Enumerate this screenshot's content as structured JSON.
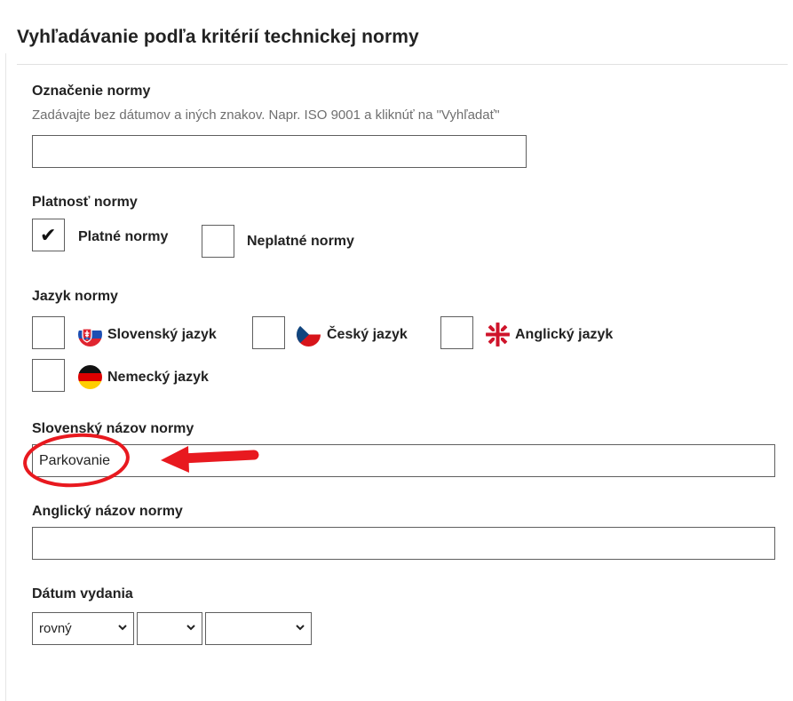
{
  "form": {
    "title": "Vyhľadávanie podľa kritérií technickej normy",
    "designation": {
      "label": "Označenie normy",
      "hint": "Zadávajte bez dátumov a iných znakov. Napr. ISO 9001 a kliknúť na \"Vyhľadať\"",
      "value": ""
    },
    "validity": {
      "label": "Platnosť normy",
      "options": [
        {
          "label": "Platné normy",
          "checked": true
        },
        {
          "label": "Neplatné normy",
          "checked": false
        }
      ]
    },
    "language": {
      "label": "Jazyk normy",
      "options": [
        {
          "label": "Slovenský jazyk",
          "flag": "slovak-flag-icon",
          "checked": false
        },
        {
          "label": "Český jazyk",
          "flag": "czech-flag-icon",
          "checked": false
        },
        {
          "label": "Anglický jazyk",
          "flag": "uk-flag-icon",
          "checked": false
        },
        {
          "label": "Nemecký jazyk",
          "flag": "german-flag-icon",
          "checked": false
        }
      ]
    },
    "sk_name": {
      "label": "Slovenský názov normy",
      "value": "Parkovanie"
    },
    "en_name": {
      "label": "Anglický názov normy",
      "value": ""
    },
    "issue_date": {
      "label": "Dátum vydania",
      "operator": "rovný",
      "month": "",
      "year": ""
    }
  },
  "annotation": {
    "color": "#e8191f",
    "shapes": [
      "ellipse-highlight",
      "arrow-left"
    ]
  }
}
